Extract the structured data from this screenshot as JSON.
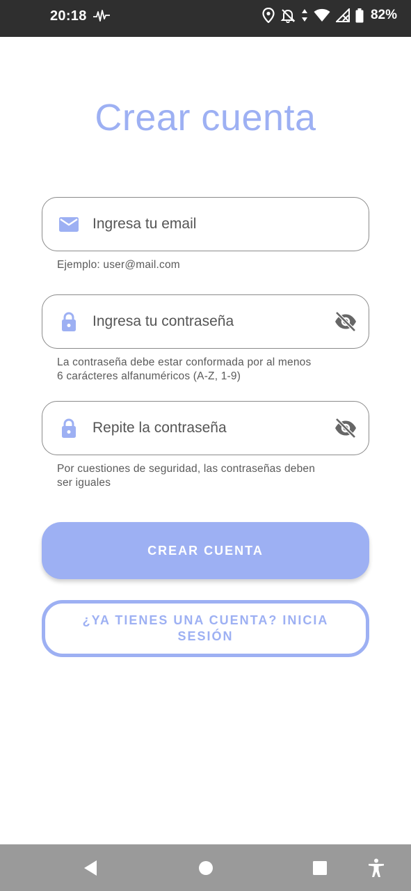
{
  "status_bar": {
    "time": "20:18",
    "battery": "82%"
  },
  "title": "Crear cuenta",
  "email_field": {
    "placeholder": "Ingresa tu email",
    "value": "",
    "helper": "Ejemplo: user@mail.com",
    "icon": "mail-icon"
  },
  "password_field": {
    "placeholder": "Ingresa tu contraseña",
    "value": "",
    "helper_line1": "La contraseña debe estar conformada por al menos",
    "helper_line2": "6 carácteres alfanuméricos (A-Z, 1-9)",
    "icon": "lock-icon",
    "toggle_icon": "visibility-off-icon"
  },
  "repeat_password_field": {
    "placeholder": "Repite la contraseña",
    "value": "",
    "helper_line1": "Por cuestiones de seguridad, las contraseñas deben",
    "helper_line2": "ser iguales",
    "icon": "lock-icon",
    "toggle_icon": "visibility-off-icon"
  },
  "buttons": {
    "create_account": "CREAR CUENTA",
    "login_line1": "¿YA TIENES UNA CUENTA? INICIA",
    "login_line2": "SESIÓN"
  },
  "colors": {
    "accent": "#9db0f3",
    "status_bar": "#2f2f2f",
    "nav_bar": "#9a9a9a"
  }
}
